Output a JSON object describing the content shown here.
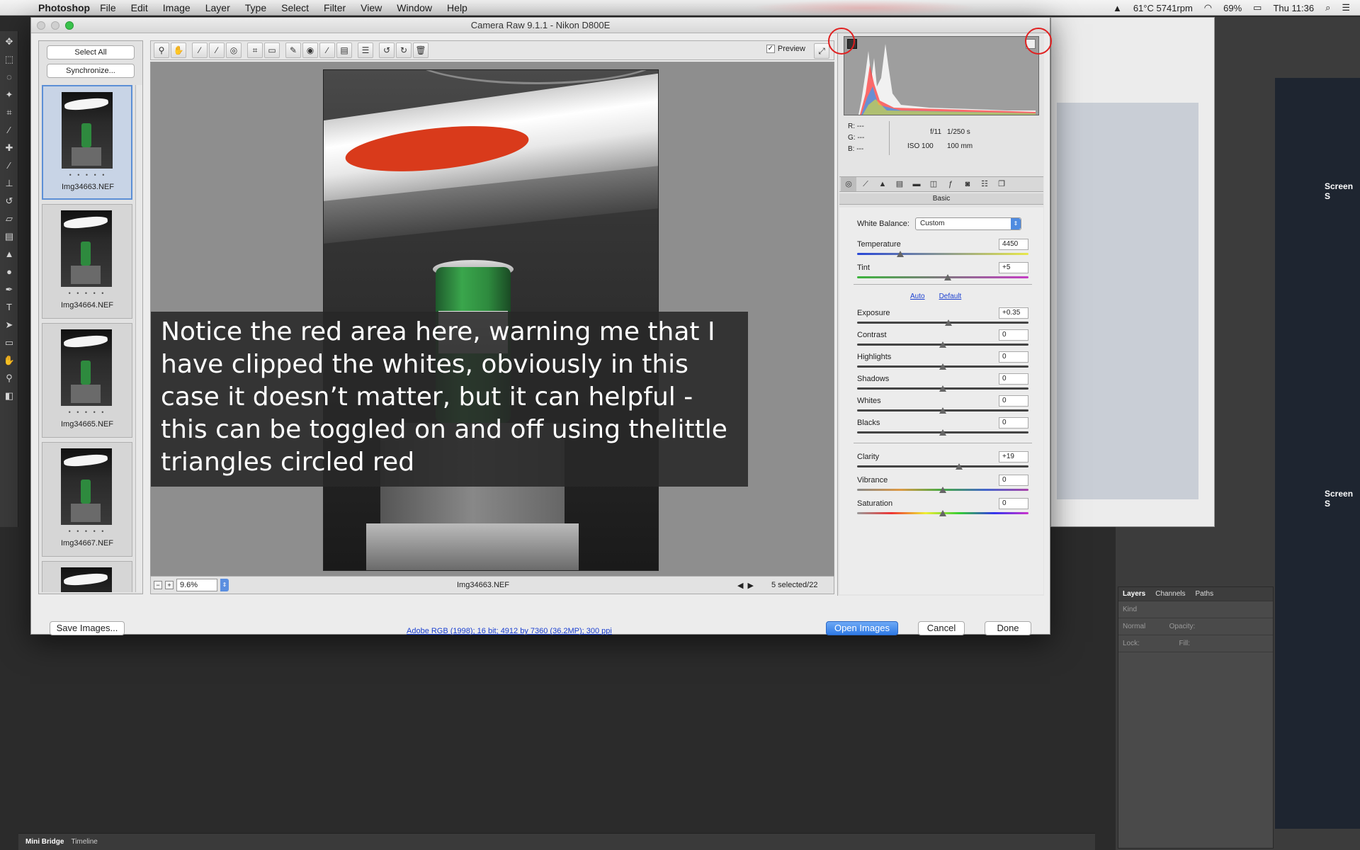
{
  "menubar": {
    "app": "Photoshop",
    "items": [
      "File",
      "Edit",
      "Image",
      "Layer",
      "Type",
      "Select",
      "Filter",
      "View",
      "Window",
      "Help"
    ],
    "status": {
      "temp": "61°C 5741rpm",
      "battery": "69%",
      "clock": "Thu 11:36"
    }
  },
  "dialog": {
    "title": "Camera Raw 9.1.1  -  Nikon D800E"
  },
  "filmstrip": {
    "select_all": "Select All",
    "synchronize": "Synchronize...",
    "items": [
      {
        "name": "Img34663.NEF",
        "stars": "• • • • •"
      },
      {
        "name": "Img34664.NEF",
        "stars": "• • • • •"
      },
      {
        "name": "Img34665.NEF",
        "stars": "• • • • •"
      },
      {
        "name": "Img34667.NEF",
        "stars": "• • • • •"
      }
    ]
  },
  "toolbar": {
    "preview_label": "Preview",
    "preview_checked": "✓"
  },
  "canvas": {
    "caption": "Notice the red area here, warning me that I have clipped the whites, obviously in this case it doesn’t matter, but it can helpful - this can be toggled on and off using thelittle triangles circled red",
    "zoom": "9.6%",
    "filename": "Img34663.NEF",
    "selected": "5 selected/22"
  },
  "readout": {
    "r": "R:   ---",
    "g": "G:   ---",
    "b": "B:   ---",
    "aperture": "f/11",
    "shutter": "1/250 s",
    "iso": "ISO 100",
    "focal": "100 mm"
  },
  "panel": {
    "title": "Basic",
    "white_balance_label": "White Balance:",
    "white_balance_value": "Custom",
    "auto": "Auto",
    "default": "Default",
    "sliders": {
      "temperature": {
        "label": "Temperature",
        "value": "4450"
      },
      "tint": {
        "label": "Tint",
        "value": "+5"
      },
      "exposure": {
        "label": "Exposure",
        "value": "+0.35"
      },
      "contrast": {
        "label": "Contrast",
        "value": "0"
      },
      "highlights": {
        "label": "Highlights",
        "value": "0"
      },
      "shadows": {
        "label": "Shadows",
        "value": "0"
      },
      "whites": {
        "label": "Whites",
        "value": "0"
      },
      "blacks": {
        "label": "Blacks",
        "value": "0"
      },
      "clarity": {
        "label": "Clarity",
        "value": "+19"
      },
      "vibrance": {
        "label": "Vibrance",
        "value": "0"
      },
      "saturation": {
        "label": "Saturation",
        "value": "0"
      }
    }
  },
  "bottom": {
    "save": "Save Images...",
    "workflow": "Adobe RGB (1998); 16 bit; 4912 by 7360 (36.2MP); 300 ppi",
    "open": "Open Images",
    "cancel": "Cancel",
    "done": "Done"
  },
  "background": {
    "layers_tabs": [
      "Layers",
      "Channels",
      "Paths"
    ],
    "kind": "Kind",
    "blend": "Normal",
    "opacity": "Opacity:",
    "lock": "Lock:",
    "fill": "Fill:",
    "bottom_tabs": [
      "Mini Bridge",
      "Timeline"
    ],
    "screen_label": "Screen S"
  },
  "colors": {
    "clip_warning": "#d93a1b",
    "circle": "#e02020",
    "accent": "#2f7ae5"
  }
}
